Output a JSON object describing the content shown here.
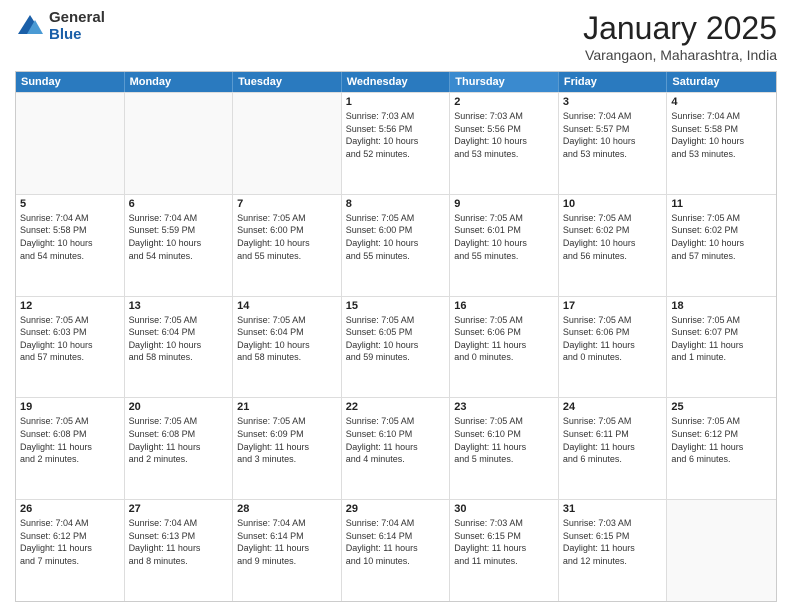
{
  "logo": {
    "general": "General",
    "blue": "Blue"
  },
  "header": {
    "month": "January 2025",
    "location": "Varangaon, Maharashtra, India"
  },
  "day_headers": [
    "Sunday",
    "Monday",
    "Tuesday",
    "Wednesday",
    "Thursday",
    "Friday",
    "Saturday"
  ],
  "weeks": [
    [
      {
        "day": "",
        "info": ""
      },
      {
        "day": "",
        "info": ""
      },
      {
        "day": "",
        "info": ""
      },
      {
        "day": "1",
        "info": "Sunrise: 7:03 AM\nSunset: 5:56 PM\nDaylight: 10 hours\nand 52 minutes."
      },
      {
        "day": "2",
        "info": "Sunrise: 7:03 AM\nSunset: 5:56 PM\nDaylight: 10 hours\nand 53 minutes."
      },
      {
        "day": "3",
        "info": "Sunrise: 7:04 AM\nSunset: 5:57 PM\nDaylight: 10 hours\nand 53 minutes."
      },
      {
        "day": "4",
        "info": "Sunrise: 7:04 AM\nSunset: 5:58 PM\nDaylight: 10 hours\nand 53 minutes."
      }
    ],
    [
      {
        "day": "5",
        "info": "Sunrise: 7:04 AM\nSunset: 5:58 PM\nDaylight: 10 hours\nand 54 minutes."
      },
      {
        "day": "6",
        "info": "Sunrise: 7:04 AM\nSunset: 5:59 PM\nDaylight: 10 hours\nand 54 minutes."
      },
      {
        "day": "7",
        "info": "Sunrise: 7:05 AM\nSunset: 6:00 PM\nDaylight: 10 hours\nand 55 minutes."
      },
      {
        "day": "8",
        "info": "Sunrise: 7:05 AM\nSunset: 6:00 PM\nDaylight: 10 hours\nand 55 minutes."
      },
      {
        "day": "9",
        "info": "Sunrise: 7:05 AM\nSunset: 6:01 PM\nDaylight: 10 hours\nand 55 minutes."
      },
      {
        "day": "10",
        "info": "Sunrise: 7:05 AM\nSunset: 6:02 PM\nDaylight: 10 hours\nand 56 minutes."
      },
      {
        "day": "11",
        "info": "Sunrise: 7:05 AM\nSunset: 6:02 PM\nDaylight: 10 hours\nand 57 minutes."
      }
    ],
    [
      {
        "day": "12",
        "info": "Sunrise: 7:05 AM\nSunset: 6:03 PM\nDaylight: 10 hours\nand 57 minutes."
      },
      {
        "day": "13",
        "info": "Sunrise: 7:05 AM\nSunset: 6:04 PM\nDaylight: 10 hours\nand 58 minutes."
      },
      {
        "day": "14",
        "info": "Sunrise: 7:05 AM\nSunset: 6:04 PM\nDaylight: 10 hours\nand 58 minutes."
      },
      {
        "day": "15",
        "info": "Sunrise: 7:05 AM\nSunset: 6:05 PM\nDaylight: 10 hours\nand 59 minutes."
      },
      {
        "day": "16",
        "info": "Sunrise: 7:05 AM\nSunset: 6:06 PM\nDaylight: 11 hours\nand 0 minutes."
      },
      {
        "day": "17",
        "info": "Sunrise: 7:05 AM\nSunset: 6:06 PM\nDaylight: 11 hours\nand 0 minutes."
      },
      {
        "day": "18",
        "info": "Sunrise: 7:05 AM\nSunset: 6:07 PM\nDaylight: 11 hours\nand 1 minute."
      }
    ],
    [
      {
        "day": "19",
        "info": "Sunrise: 7:05 AM\nSunset: 6:08 PM\nDaylight: 11 hours\nand 2 minutes."
      },
      {
        "day": "20",
        "info": "Sunrise: 7:05 AM\nSunset: 6:08 PM\nDaylight: 11 hours\nand 2 minutes."
      },
      {
        "day": "21",
        "info": "Sunrise: 7:05 AM\nSunset: 6:09 PM\nDaylight: 11 hours\nand 3 minutes."
      },
      {
        "day": "22",
        "info": "Sunrise: 7:05 AM\nSunset: 6:10 PM\nDaylight: 11 hours\nand 4 minutes."
      },
      {
        "day": "23",
        "info": "Sunrise: 7:05 AM\nSunset: 6:10 PM\nDaylight: 11 hours\nand 5 minutes."
      },
      {
        "day": "24",
        "info": "Sunrise: 7:05 AM\nSunset: 6:11 PM\nDaylight: 11 hours\nand 6 minutes."
      },
      {
        "day": "25",
        "info": "Sunrise: 7:05 AM\nSunset: 6:12 PM\nDaylight: 11 hours\nand 6 minutes."
      }
    ],
    [
      {
        "day": "26",
        "info": "Sunrise: 7:04 AM\nSunset: 6:12 PM\nDaylight: 11 hours\nand 7 minutes."
      },
      {
        "day": "27",
        "info": "Sunrise: 7:04 AM\nSunset: 6:13 PM\nDaylight: 11 hours\nand 8 minutes."
      },
      {
        "day": "28",
        "info": "Sunrise: 7:04 AM\nSunset: 6:14 PM\nDaylight: 11 hours\nand 9 minutes."
      },
      {
        "day": "29",
        "info": "Sunrise: 7:04 AM\nSunset: 6:14 PM\nDaylight: 11 hours\nand 10 minutes."
      },
      {
        "day": "30",
        "info": "Sunrise: 7:03 AM\nSunset: 6:15 PM\nDaylight: 11 hours\nand 11 minutes."
      },
      {
        "day": "31",
        "info": "Sunrise: 7:03 AM\nSunset: 6:15 PM\nDaylight: 11 hours\nand 12 minutes."
      },
      {
        "day": "",
        "info": ""
      }
    ]
  ]
}
